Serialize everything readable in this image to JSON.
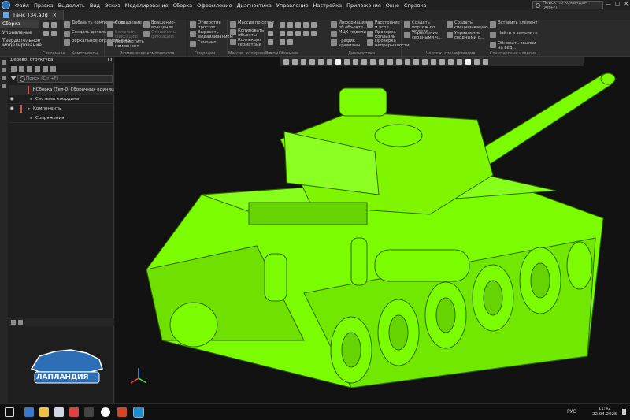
{
  "menu": [
    "Файл",
    "Правка",
    "Выделить",
    "Вид",
    "Эскиз",
    "Моделирование",
    "Сборка",
    "Оформление",
    "Диагностика",
    "Управление",
    "Настройка",
    "Приложения",
    "Окно",
    "Справка"
  ],
  "search_placeholder": "Поиск по командам (Alt+/)",
  "document_tab": "Танк Т34.a3d",
  "ribbon_side": [
    "Сборка",
    "Управление",
    "Твердотельное моделирование"
  ],
  "ribbon": {
    "system": {
      "label": "Системная"
    },
    "components": {
      "label": "Компоненты",
      "cmds": [
        "Добавить компонент из...",
        "Создать деталь",
        "Зеркальное отражение ко..."
      ]
    },
    "placement": {
      "label": "Размещение компонентов",
      "cmds": [
        "Совпадение",
        "Вращение-вращение",
        "Включить фиксацию",
        "Отключить фиксацию",
        "Переместить компонент"
      ]
    },
    "operations": {
      "label": "Операции",
      "cmds": [
        "Отверстие простое",
        "Вырезать выдавливанием",
        "Сечение"
      ]
    },
    "mass": {
      "label": "Массив, копирование",
      "cmds": [
        "Массив по сетке",
        "Копировать объекты",
        "Коллекция геометрии"
      ]
    },
    "aux": {
      "label": "Вспом..."
    },
    "markup": {
      "label": "Обозначе..."
    },
    "diagnostics": {
      "label": "Диагностика",
      "cmds": [
        "Информация об объекте",
        "МЦХ модели",
        "График кривизны",
        "Расстояние и угол",
        "Проверка коллизий",
        "Проверка непрерывности"
      ]
    },
    "drawing": {
      "label": "Чертеж, спецификация",
      "cmds": [
        "Создать чертеж по модели",
        "Управление сводными ч...",
        "Создать спецификацию...",
        "Управление сводными с..."
      ]
    },
    "standard": {
      "label": "Стандартные изделия",
      "cmds": [
        "Вставить элемент",
        "Найти и заменить",
        "Обновить ссылки на вед..."
      ]
    }
  },
  "tree": {
    "title": "Дерево: структура",
    "search_placeholder": "Поиск (Ctrl+F)",
    "rows": [
      "НСборка (Тел-0, Сборочных единиц-0",
      "Системы координат",
      "Компоненты",
      "Сопряжения"
    ]
  },
  "logo_text": "ЛАПЛАНДИЯ",
  "taskbar": {
    "lang": "РУС",
    "time": "11:42",
    "date": "22.04.2025"
  },
  "colors": {
    "model": "#7CFC00",
    "accent": "#2d6fb6"
  }
}
